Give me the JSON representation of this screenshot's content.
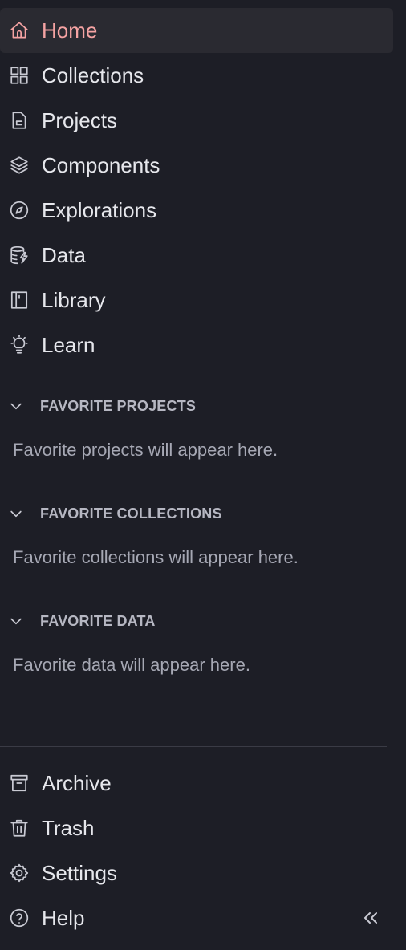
{
  "nav": {
    "items": [
      {
        "label": "Home",
        "icon": "home-icon",
        "active": true
      },
      {
        "label": "Collections",
        "icon": "grid-icon"
      },
      {
        "label": "Projects",
        "icon": "file-icon"
      },
      {
        "label": "Components",
        "icon": "layers-icon"
      },
      {
        "label": "Explorations",
        "icon": "compass-icon"
      },
      {
        "label": "Data",
        "icon": "database-icon"
      },
      {
        "label": "Library",
        "icon": "book-icon"
      },
      {
        "label": "Learn",
        "icon": "lightbulb-icon"
      }
    ]
  },
  "favorites": {
    "projects": {
      "title": "FAVORITE PROJECTS",
      "empty": "Favorite projects will appear here."
    },
    "collections": {
      "title": "FAVORITE COLLECTIONS",
      "empty": "Favorite collections will appear here."
    },
    "data": {
      "title": "FAVORITE DATA",
      "empty": "Favorite data will appear here."
    }
  },
  "bottom": {
    "items": [
      {
        "label": "Archive",
        "icon": "archive-icon"
      },
      {
        "label": "Trash",
        "icon": "trash-icon"
      },
      {
        "label": "Settings",
        "icon": "gear-icon"
      },
      {
        "label": "Help",
        "icon": "help-icon"
      }
    ]
  },
  "colors": {
    "background": "#1d1e26",
    "active_bg": "#2a2a31",
    "active_text": "#f5a3a3",
    "text": "#e6e7ec",
    "muted_text": "#a6a8b4"
  }
}
